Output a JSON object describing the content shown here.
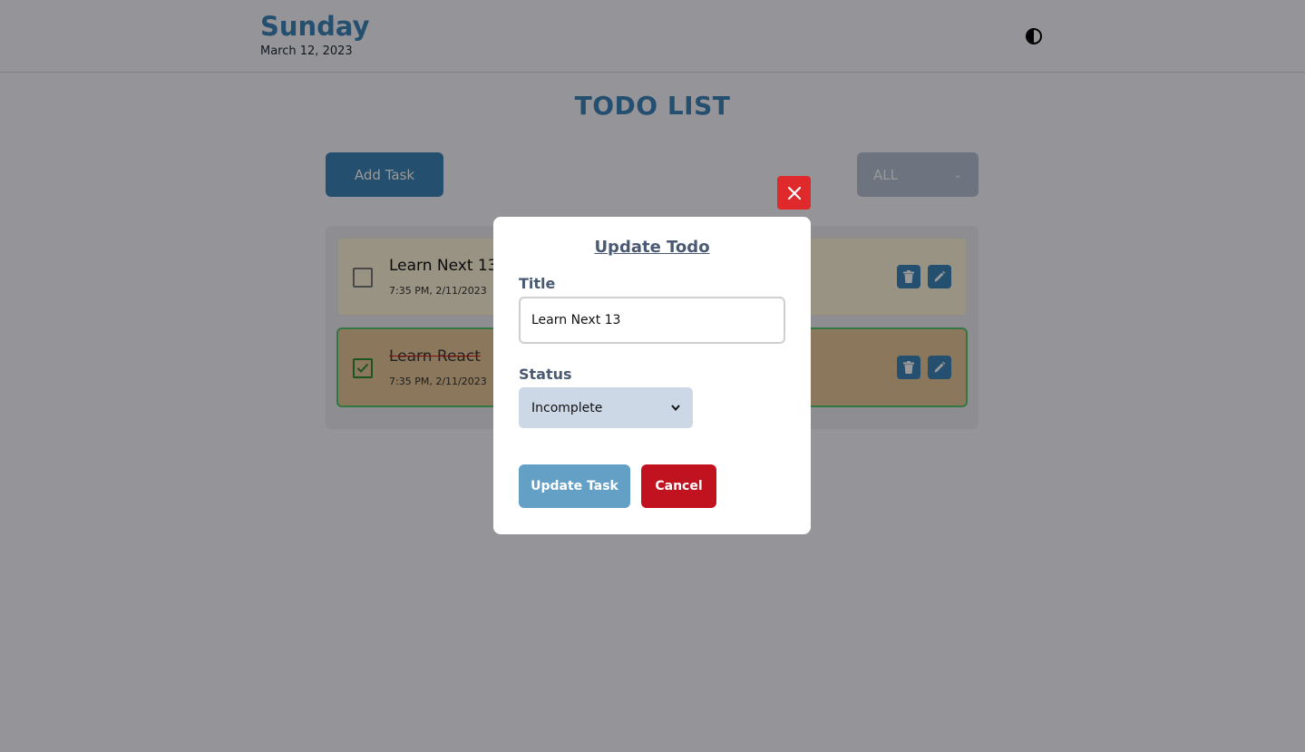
{
  "header": {
    "day": "Sunday",
    "date": "March 12, 2023",
    "theme_toggle_icon": "half-moon-icon"
  },
  "main": {
    "title": "TODO LIST",
    "add_button_label": "Add Task",
    "filter": {
      "selected": "ALL"
    }
  },
  "todos": [
    {
      "title": "Learn Next 13",
      "time": "7:35 PM, 2/11/2023",
      "status": "incomplete"
    },
    {
      "title": "Learn React",
      "time": "7:35 PM, 2/11/2023",
      "status": "complete"
    }
  ],
  "modal": {
    "heading": "Update Todo",
    "title_label": "Title",
    "title_value": "Learn Next 13",
    "status_label": "Status",
    "status_selected": "Incomplete",
    "update_button": "Update Task",
    "cancel_button": "Cancel"
  },
  "colors": {
    "accent": "#3d84b8",
    "danger": "#e0292b",
    "cancel": "#c0131f",
    "complete_border": "#58c770"
  }
}
